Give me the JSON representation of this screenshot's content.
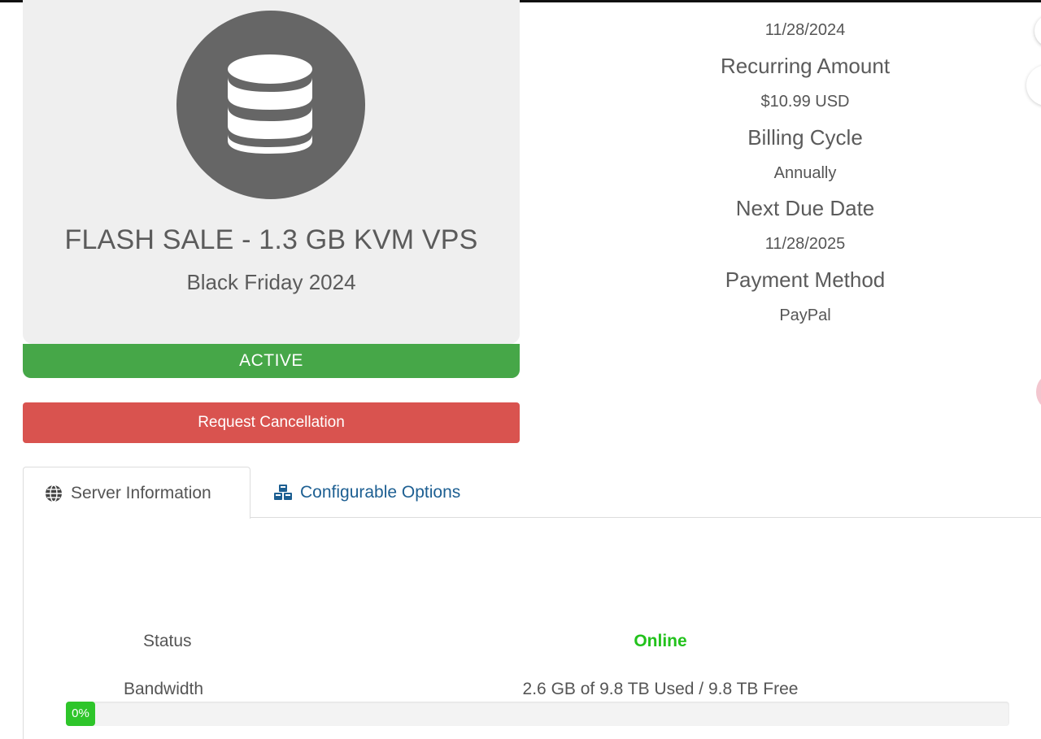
{
  "product": {
    "icon": "database-icon",
    "name": "FLASH SALE - 1.3 GB KVM VPS",
    "group": "Black Friday 2024",
    "status": "ACTIVE",
    "status_color": "#46a748"
  },
  "actions": {
    "cancel_label": "Request Cancellation",
    "cancel_color": "#d9534f"
  },
  "billing": {
    "registration_date": "11/28/2024",
    "recurring_amount_label": "Recurring Amount",
    "recurring_amount": "$10.99 USD",
    "billing_cycle_label": "Billing Cycle",
    "billing_cycle": "Annually",
    "next_due_label": "Next Due Date",
    "next_due": "11/28/2025",
    "payment_method_label": "Payment Method",
    "payment_method": "PayPal"
  },
  "tabs": [
    {
      "label": "Server Information",
      "icon": "globe-icon",
      "active": true
    },
    {
      "label": "Configurable Options",
      "icon": "cubes-icon",
      "active": false
    }
  ],
  "server_info": {
    "status_label": "Status",
    "status_value": "Online",
    "status_color": "#22c21c",
    "bandwidth_label": "Bandwidth",
    "bandwidth_value": "2.6 GB of 9.8 TB Used / 9.8 TB Free",
    "bandwidth_percent_label": "0%",
    "bandwidth_fraction": 0.0,
    "bar_color": "#2ec52a"
  }
}
